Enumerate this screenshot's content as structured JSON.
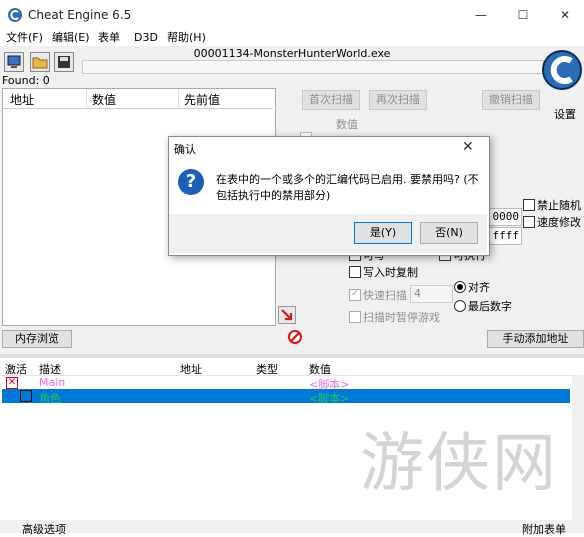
{
  "window": {
    "title": "Cheat Engine 6.5",
    "minimize": "—",
    "maximize": "☐",
    "close": "✕"
  },
  "menu": [
    "文件(F)",
    "编辑(E)",
    "表单",
    "D3D",
    "帮助(H)"
  ],
  "process": "00001134-MonsterHunterWorld.exe",
  "found": "Found: 0",
  "results_headers": [
    "地址",
    "数值",
    "先前值"
  ],
  "scan": {
    "first_scan": "首次扫描",
    "next_scan": "再次扫描",
    "undo_scan": "撤销扫描",
    "value_label": "数值",
    "settings": "设置",
    "hex_start": "0000",
    "hex_end": "ffff",
    "writable": "可写",
    "executable": "可执行",
    "copy_on_write": "写入时复制",
    "fast_scan": "快速扫描",
    "fast_scan_value": "4",
    "align": "对齐",
    "last_digits": "最后数字",
    "pause_game": "扫描时暂停游戏",
    "disable_random": "禁止随机",
    "speedhack": "速度修改"
  },
  "buttons": {
    "memory_view": "内存浏览",
    "add_address": "手动添加地址"
  },
  "table": {
    "headers": [
      "激活",
      "描述",
      "地址",
      "类型",
      "数值"
    ],
    "rows": [
      {
        "desc": "Main",
        "value": "<脚本>",
        "color": "#e86de8"
      },
      {
        "desc": "角色",
        "value": "<脚本>",
        "color": "#22c55e"
      }
    ]
  },
  "footer": {
    "advanced": "高级选项",
    "table_extras": "附加表单"
  },
  "watermark": "游侠网",
  "dialog": {
    "title": "确认",
    "message": "在表中的一个或多个的汇编代码已启用. 要禁用吗? (不包括执行中的禁用部分)",
    "yes": "是(Y)",
    "no": "否(N)"
  }
}
